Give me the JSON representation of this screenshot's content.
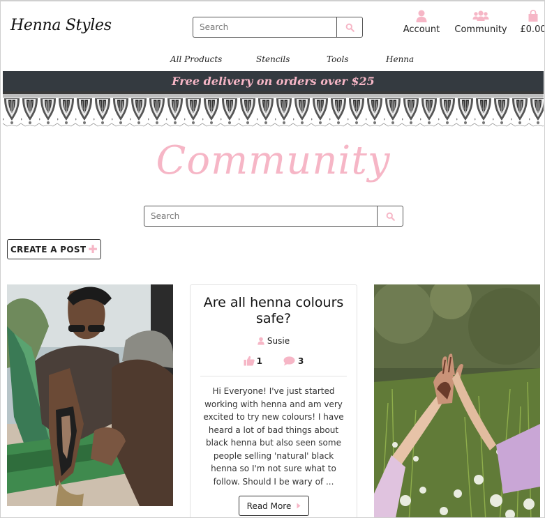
{
  "brand": "Henna Styles",
  "header": {
    "search_placeholder": "Search",
    "account_label": "Account",
    "community_label": "Community",
    "cart_label": "£0.00"
  },
  "nav": {
    "items": [
      "All Products",
      "Stencils",
      "Tools",
      "Henna"
    ]
  },
  "banner": "Free delivery on orders over $25",
  "page": {
    "title": "Community",
    "search_placeholder": "Search",
    "create_post_label": "CREATE A POST"
  },
  "post": {
    "title": "Are all henna colours safe?",
    "author": "Susie",
    "likes": "1",
    "comments": "3",
    "excerpt": "Hi Everyone! I've just started working with henna and am very excited to try new colours! I have heard a lot of bad things about black henna but also seen some people selling 'natural' black henna so I'm not sure what to follow. Should I be wary of ...",
    "read_more_label": "Read More"
  },
  "colors": {
    "accent_pink": "#f6b6c6",
    "banner_bg": "#343a40",
    "text": "#222222"
  },
  "icons": [
    "search-icon",
    "account-icon",
    "community-icon",
    "shopping-bag-icon",
    "plus-icon",
    "user-icon",
    "thumbs-up-icon",
    "comment-icon",
    "caret-right-icon"
  ]
}
